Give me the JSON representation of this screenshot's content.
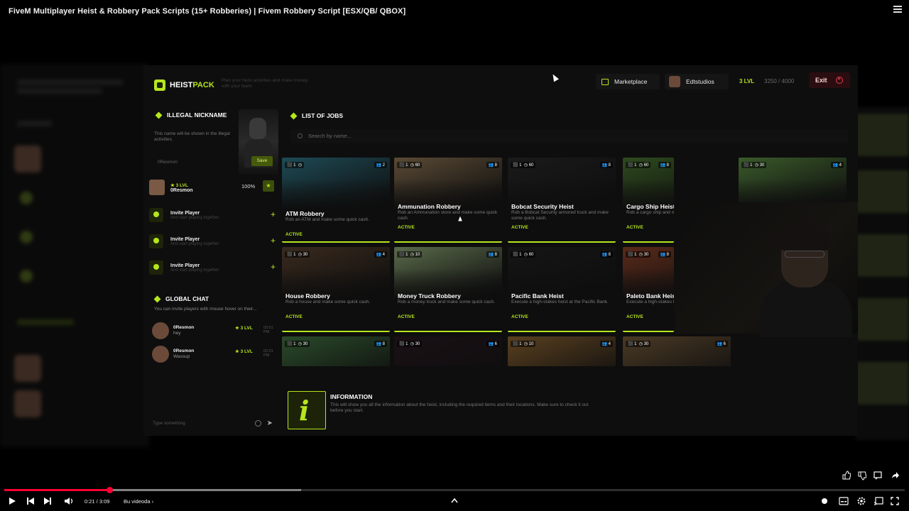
{
  "video": {
    "title": "FiveM Multiplayer Heist & Robbery Pack Scripts (15+ Robberies) | Fivem Robbery Script [ESX/QB/ QBOX]",
    "time": "0:21 / 3:09",
    "chapter": "Bu videoda",
    "progress_played": 0.117,
    "progress_buffered": 0.33
  },
  "app": {
    "logo": {
      "part1": "HEIST",
      "part2": "PACK"
    },
    "tagline": "Plan your heist activities and make money with your team.",
    "marketplace_label": "Marketplace",
    "username": "Edtstudios",
    "level": "3 LVL",
    "xp": "3250 / 4000",
    "exit_label": "Exit"
  },
  "left": {
    "nickname_title": "ILLEGAL NICKNAME",
    "nickname_desc": "This name will be shown in the illegal activities.",
    "nickname_value": "0Resmon",
    "save_label": "Save",
    "profile": {
      "level": "★ 3 LVL",
      "name": "0Resmon",
      "percent": "100%"
    },
    "invites": [
      {
        "title": "Invite Player",
        "subtitle": "And start playing together"
      },
      {
        "title": "Invite Player",
        "subtitle": "And start playing together"
      },
      {
        "title": "Invite Player",
        "subtitle": "And start playing together"
      }
    ],
    "chat_title": "GLOBAL CHAT",
    "chat_desc": "You can invite players with mouse hover on their...",
    "messages": [
      {
        "name": "0Resmon",
        "text": "hey",
        "level": "★ 3 LVL",
        "time": "03:01 PM"
      },
      {
        "name": "0Resmon",
        "text": "Wassup",
        "level": "★ 3 LVL",
        "time": "03:01 PM"
      }
    ],
    "chat_placeholder": "Type something"
  },
  "jobs": {
    "title": "LIST OF JOBS",
    "search_placeholder": "Search by name...",
    "cards": [
      {
        "name": "ATM Robbery",
        "desc": "Rob an ATM and make some quick cash.",
        "status": "ACTIVE",
        "players": "2",
        "time": "",
        "color": "#1e4a55"
      },
      {
        "name": "Ammunation Robbery",
        "desc": "Rob an Ammunation store and make some quick cash.",
        "status": "ACTIVE",
        "players": "8",
        "time": "60",
        "color": "#5a4a35"
      },
      {
        "name": "Bobcat Security Heist",
        "desc": "Rob a Bobcat Security armored truck and make some quick cash.",
        "status": "ACTIVE",
        "players": "8",
        "time": "60",
        "color": "#1a1a1a"
      },
      {
        "name": "Cargo Ship Heist",
        "desc": "Rob a cargo ship and make some quick cash.",
        "status": "ACTIVE",
        "players": "8",
        "time": "60",
        "color": "#2e4a1e"
      },
      {
        "name": "",
        "desc": "",
        "status": "",
        "players": "4",
        "time": "30",
        "color": "#3a5a2a"
      },
      {
        "name": "House Robbery",
        "desc": "Rob a house and make some quick cash.",
        "status": "ACTIVE",
        "players": "4",
        "time": "30",
        "color": "#3a2a1e"
      },
      {
        "name": "Money Truck Robbery",
        "desc": "Rob a money truck and make some quick cash.",
        "status": "ACTIVE",
        "players": "8",
        "time": "10",
        "color": "#5a6a4a"
      },
      {
        "name": "Pacific Bank Heist",
        "desc": "Execute a high-stakes heist at the Pacific Bank.",
        "status": "ACTIVE",
        "players": "8",
        "time": "60",
        "color": "#151515"
      },
      {
        "name": "Paleto Bank Heist",
        "desc": "Execute a high-stakes heist at the Paleto Bank.",
        "status": "ACTIVE",
        "players": "8",
        "time": "30",
        "color": "#5a2a1a"
      },
      {
        "name": "",
        "desc": "",
        "status": "",
        "players": "8",
        "time": "30",
        "color": "#4a3020"
      },
      {
        "name": "",
        "desc": "",
        "status": "",
        "players": "8",
        "time": "30",
        "color": "#2a4a2a"
      },
      {
        "name": "",
        "desc": "",
        "status": "",
        "players": "6",
        "time": "30",
        "color": "#1a1015"
      },
      {
        "name": "",
        "desc": "",
        "status": "",
        "players": "4",
        "time": "10",
        "color": "#5a4020"
      },
      {
        "name": "",
        "desc": "",
        "status": "",
        "players": "6",
        "time": "30",
        "color": "#4a3a25"
      }
    ]
  },
  "info": {
    "title": "INFORMATION",
    "text": "This will show you all the information about the heist, including the required items and their locations. Make sure to check it out before you start."
  },
  "colors": {
    "accent": "#b5e61d",
    "danger": "#e23b4d",
    "youtube_red": "#ff0033"
  }
}
